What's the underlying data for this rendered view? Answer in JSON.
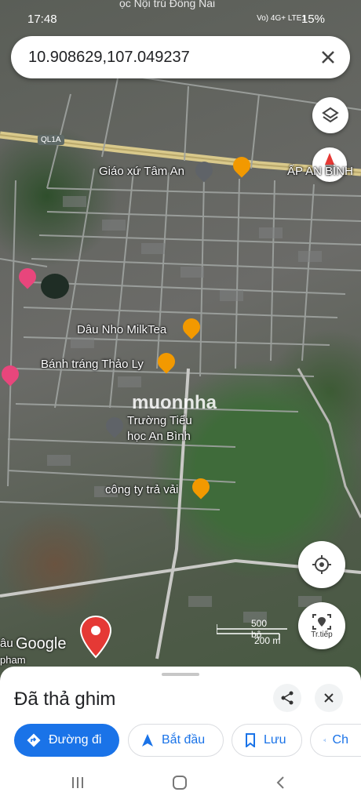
{
  "status_bar": {
    "time": "17:48",
    "carrier_overlay": "ọc Nội trú Đồng Nai",
    "network": "Vo) 4G+ LTE1",
    "battery": "15%"
  },
  "search": {
    "query": "10.908629,107.049237"
  },
  "map": {
    "road_label": "QL1A",
    "labels": {
      "church": "Giáo xứ Tâm An",
      "hamlet": "ẤP AN BÌNH",
      "milktea": "Dâu Nho MilkTea",
      "banh_trang": "Bánh tráng Thảo Ly",
      "school_line1": "Trường Tiểu",
      "school_line2": "học An Bình",
      "tea_company": "công ty trả vải",
      "left_partial1": "âu",
      "left_partial2": "pham",
      "watermark": "muonnha"
    },
    "google_logo": "Google",
    "scale": {
      "feet": "500 bộ",
      "meters": "200 m"
    },
    "directions_fab_label": "Tr.tiếp"
  },
  "sheet": {
    "title": "Đã thả ghim",
    "chips": [
      "Đường đi",
      "Bắt đầu",
      "Lưu",
      "Ch"
    ]
  },
  "colors": {
    "accent": "#1a73e8",
    "pin_red": "#e53935",
    "food_orange": "#f29900",
    "hotel_pink": "#e8467c"
  }
}
